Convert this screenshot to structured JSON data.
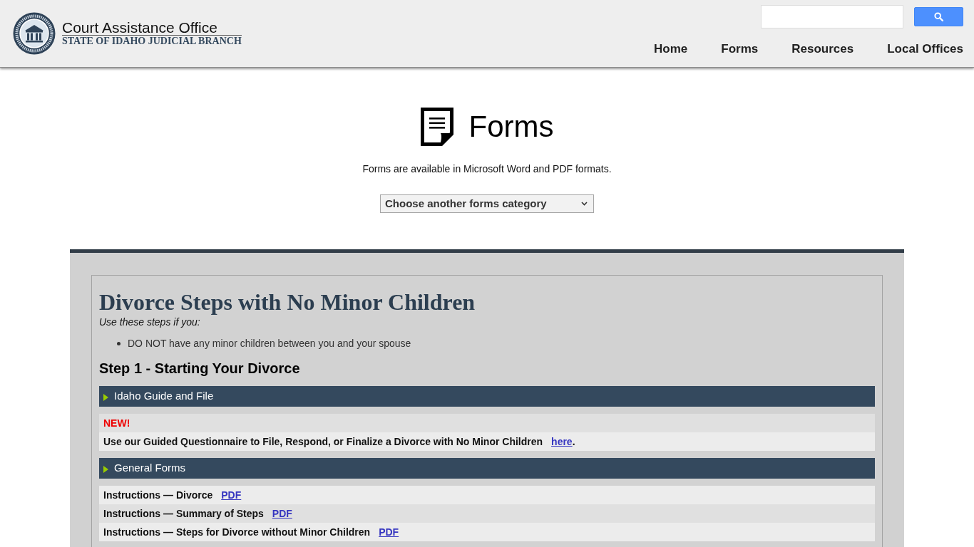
{
  "header": {
    "title": "Court Assistance Office",
    "subtitle": "STATE OF IDAHO JUDICIAL BRANCH",
    "nav": [
      "Home",
      "Forms",
      "Resources",
      "Local Offices"
    ]
  },
  "page": {
    "title": "Forms",
    "intro": "Forms are available in Microsoft Word and PDF formats.",
    "category_dropdown": {
      "value": "Choose another forms category"
    }
  },
  "guide": {
    "title": "Divorce Steps with No Minor Children",
    "lead": "Use these steps if you:",
    "conditions": [
      "DO NOT have any minor children between you and your spouse"
    ],
    "steps": [
      {
        "heading": "Step 1 - Starting Your Divorce",
        "sections": [
          {
            "title": "Idaho Guide and File",
            "rows": [
              {
                "kind": "notice",
                "text": "NEW!"
              },
              {
                "kind": "sentence",
                "text": "Use our Guided Questionnaire to File, Respond, or Finalize a Divorce with No Minor Children",
                "link": "here",
                "after": "."
              }
            ]
          },
          {
            "title": "General Forms",
            "rows": [
              {
                "kind": "form",
                "text": "Instructions — Divorce",
                "links": [
                  "PDF"
                ]
              },
              {
                "kind": "form",
                "text": "Instructions — Summary of Steps",
                "links": [
                  "PDF"
                ]
              },
              {
                "kind": "form",
                "text": "Instructions — Steps for Divorce without Minor Children",
                "links": [
                  "PDF"
                ]
              }
            ]
          }
        ]
      }
    ]
  }
}
